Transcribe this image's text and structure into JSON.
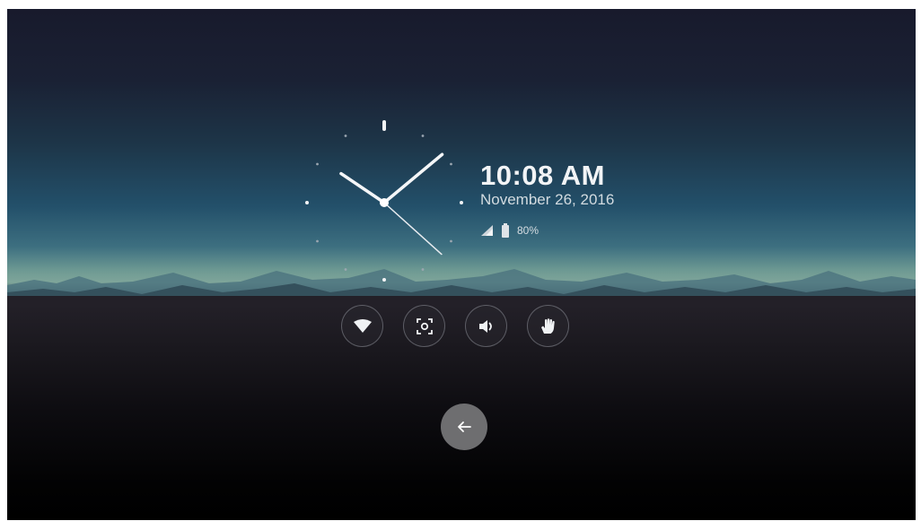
{
  "clock": {
    "time": "10:08 AM",
    "date": "November 26, 2016",
    "hour": 10,
    "minute": 8,
    "second": 22
  },
  "status": {
    "signal_icon": "signal-icon",
    "battery_icon": "battery-icon",
    "battery_text": "80%"
  },
  "quick_toggles": [
    {
      "name": "wifi-toggle",
      "icon": "wifi-icon"
    },
    {
      "name": "screenshot-toggle",
      "icon": "screenshot-icon"
    },
    {
      "name": "sound-toggle",
      "icon": "sound-icon"
    },
    {
      "name": "hand-gesture-toggle",
      "icon": "hand-icon"
    }
  ],
  "navigation": {
    "back_icon": "back-arrow-icon"
  },
  "colors": {
    "hand": "#f4f6f8",
    "text_primary": "#f2f4f6",
    "back_button_bg": "#6e6e70"
  }
}
